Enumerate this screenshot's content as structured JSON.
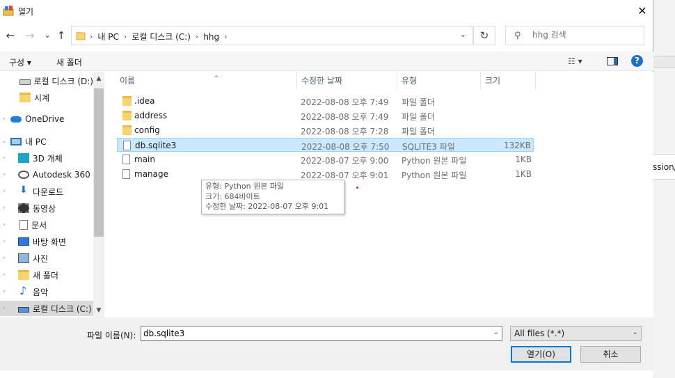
{
  "window": {
    "title": "열기",
    "close": "✕"
  },
  "nav": {
    "back": "←",
    "forward": "→",
    "recent": "⌄",
    "up": "↑"
  },
  "address": {
    "crumbs": [
      "내 PC",
      "로컬 디스크 (C:)",
      "hhg"
    ],
    "separator": "›",
    "dropdown": "⌄",
    "refresh": "↻"
  },
  "search": {
    "placeholder": "hhg 검색",
    "icon": "⚲"
  },
  "toolbar": {
    "organize": "구성 ▾",
    "new_folder": "새 폴더",
    "view": "☷ ▾",
    "help": "?"
  },
  "sidebar": {
    "items": [
      {
        "label": "로컬 디스크 (D:)",
        "icon": "drive-icon"
      },
      {
        "label": "시계",
        "icon": "folder-icon"
      },
      {
        "label": "OneDrive",
        "icon": "cloud-icon"
      },
      {
        "label": "내 PC",
        "icon": "pc-icon"
      },
      {
        "label": "3D 개체",
        "icon": "cube-icon"
      },
      {
        "label": "Autodesk 360",
        "icon": "autodesk-icon"
      },
      {
        "label": "다운로드",
        "icon": "download-icon"
      },
      {
        "label": "동영상",
        "icon": "video-icon"
      },
      {
        "label": "문서",
        "icon": "document-icon"
      },
      {
        "label": "바탕 화면",
        "icon": "desktop-icon"
      },
      {
        "label": "사진",
        "icon": "photo-icon"
      },
      {
        "label": "새 폴더",
        "icon": "folder-icon"
      },
      {
        "label": "음악",
        "icon": "music-icon"
      },
      {
        "label": "로컬 디스크 (C:)",
        "icon": "drive-icon"
      }
    ],
    "expander": "›",
    "scroll_up": "▲",
    "scroll_down": "▼"
  },
  "columns": {
    "name": "이름",
    "date": "수정한 날짜",
    "type": "유형",
    "size": "크기",
    "sort_indicator": "^"
  },
  "files": [
    {
      "name": ".idea",
      "date": "2022-08-08 오후 7:49",
      "type": "파일 폴더",
      "size": "",
      "kind": "folder"
    },
    {
      "name": "address",
      "date": "2022-08-08 오후 7:49",
      "type": "파일 폴더",
      "size": "",
      "kind": "folder"
    },
    {
      "name": "config",
      "date": "2022-08-08 오후 7:28",
      "type": "파일 폴더",
      "size": "",
      "kind": "folder"
    },
    {
      "name": "db.sqlite3",
      "date": "2022-08-08 오후 7:50",
      "type": "SQLITE3 파일",
      "size": "132KB",
      "kind": "file"
    },
    {
      "name": "main",
      "date": "2022-08-07 오후 9:00",
      "type": "Python 원본 파일",
      "size": "1KB",
      "kind": "file"
    },
    {
      "name": "manage",
      "date": "2022-08-07 오후 9:01",
      "type": "Python 원본 파일",
      "size": "1KB",
      "kind": "file"
    }
  ],
  "tooltip": {
    "line1": "유형: Python 원본 파일",
    "line2": "크기: 684바이트",
    "line3": "수정한 날짜: 2022-08-07 오후 9:01"
  },
  "footer": {
    "filename_label": "파일 이름(N):",
    "filename_value": "db.sqlite3",
    "filter_value": "All files (*.*)",
    "dropdown": "⌄",
    "open_button": "열기(O)",
    "cancel_button": "취소"
  },
  "background_app": {
    "text": "ssion/"
  }
}
